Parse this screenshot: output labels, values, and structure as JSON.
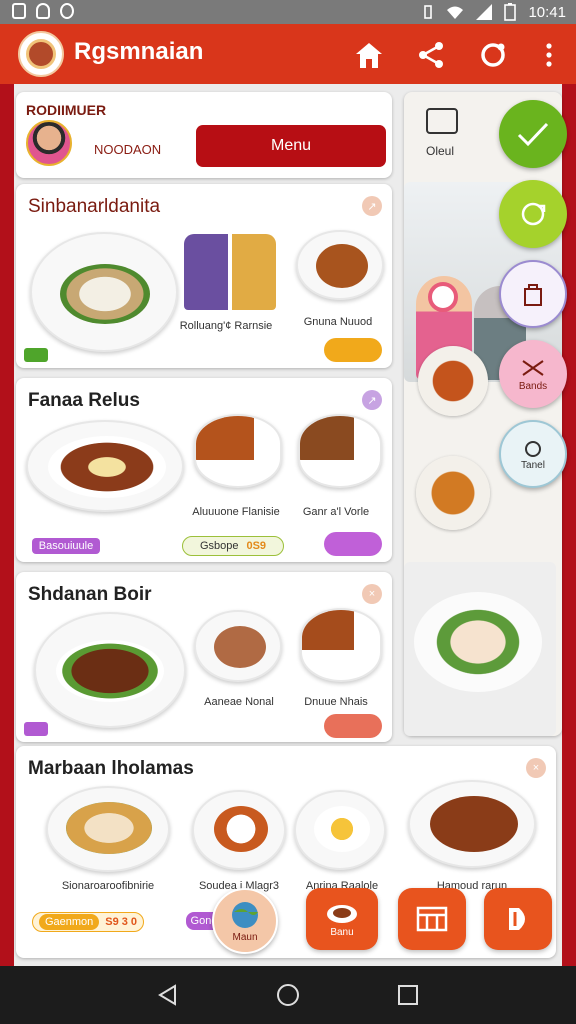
{
  "status_bar": {
    "time": "10:41"
  },
  "app": {
    "title": "Rgsmnaian"
  },
  "profile": {
    "name": "RODIIMUER",
    "subtitle": "NOODAON",
    "menu_label": "Menu"
  },
  "side": {
    "caption": "Oleul"
  },
  "fabs": [
    {
      "label": ""
    },
    {
      "label": ""
    },
    {
      "label": ""
    },
    {
      "label": "Bands"
    },
    {
      "label": "Tanel"
    }
  ],
  "sections": [
    {
      "title": "Sinbanarldanita",
      "captions": [
        "Rolluang'¢ Rarnsie",
        "Gnuna Nuuod"
      ]
    },
    {
      "title": "Fanaa Relus",
      "captions": [
        "Aluuuone Flanisie",
        "Ganr a'l Vorle"
      ],
      "pills": [
        "Basouiuule",
        "Gsbope",
        "0S9"
      ]
    },
    {
      "title": "Shdanan Boir",
      "captions": [
        "Aaneae Nonal",
        "Dnuue Nhais"
      ]
    },
    {
      "title": "Marbaan lholamas",
      "captions": [
        "Sionaroaroofibnirie",
        "Soudea i Mlagr3",
        "Anrina Raalole",
        "Hamoud rarun"
      ],
      "pills": [
        "Gaenmon",
        "S9 3 0",
        "Gone"
      ]
    }
  ],
  "bottom_nav": [
    {
      "label": "Maun"
    },
    {
      "label": "Banu"
    },
    {
      "label": ""
    },
    {
      "label": ""
    }
  ]
}
